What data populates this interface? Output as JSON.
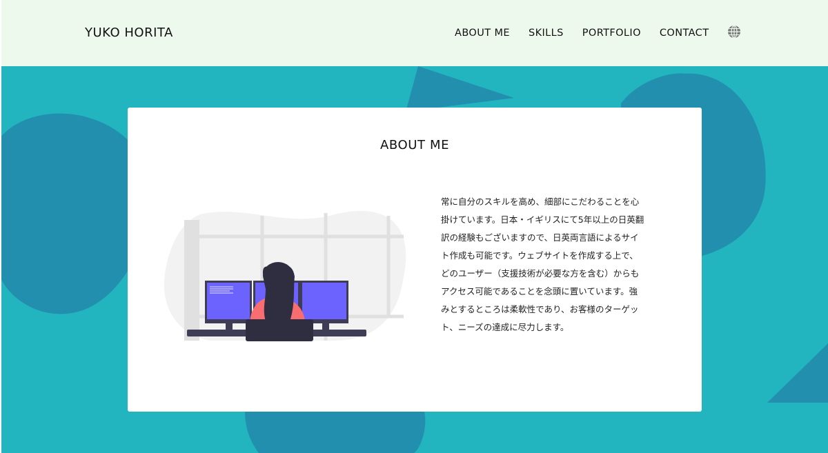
{
  "header": {
    "logo": "YUKO HORITA",
    "nav": [
      "ABOUT ME",
      "SKILLS",
      "PORTFOLIO",
      "CONTACT"
    ],
    "language_icon": "globe-icon"
  },
  "about": {
    "title": "ABOUT ME",
    "text": "常に自分のスキルを高め、細部にこだわることを心掛けています。日本・イギリスにて5年以上の日英翻訳の経験もございますので、日英両言語によるサイト作成も可能です。ウェブサイトを作成する上で、どのユーザー（支援技術が必要な方を含む）からもアクセス可能であることを念頭に置いています。強みとするところは柔軟性であり、お客様のターゲット、ニーズの達成に尽力します。",
    "illustration": "woman-at-computer-monitors"
  },
  "colors": {
    "header_bg": "#eef9ee",
    "page_bg": "#22b5bf",
    "shape": "#228fae",
    "accent": "#6c63ff",
    "figure_top": "#f86d70",
    "hair": "#2f2e41"
  }
}
